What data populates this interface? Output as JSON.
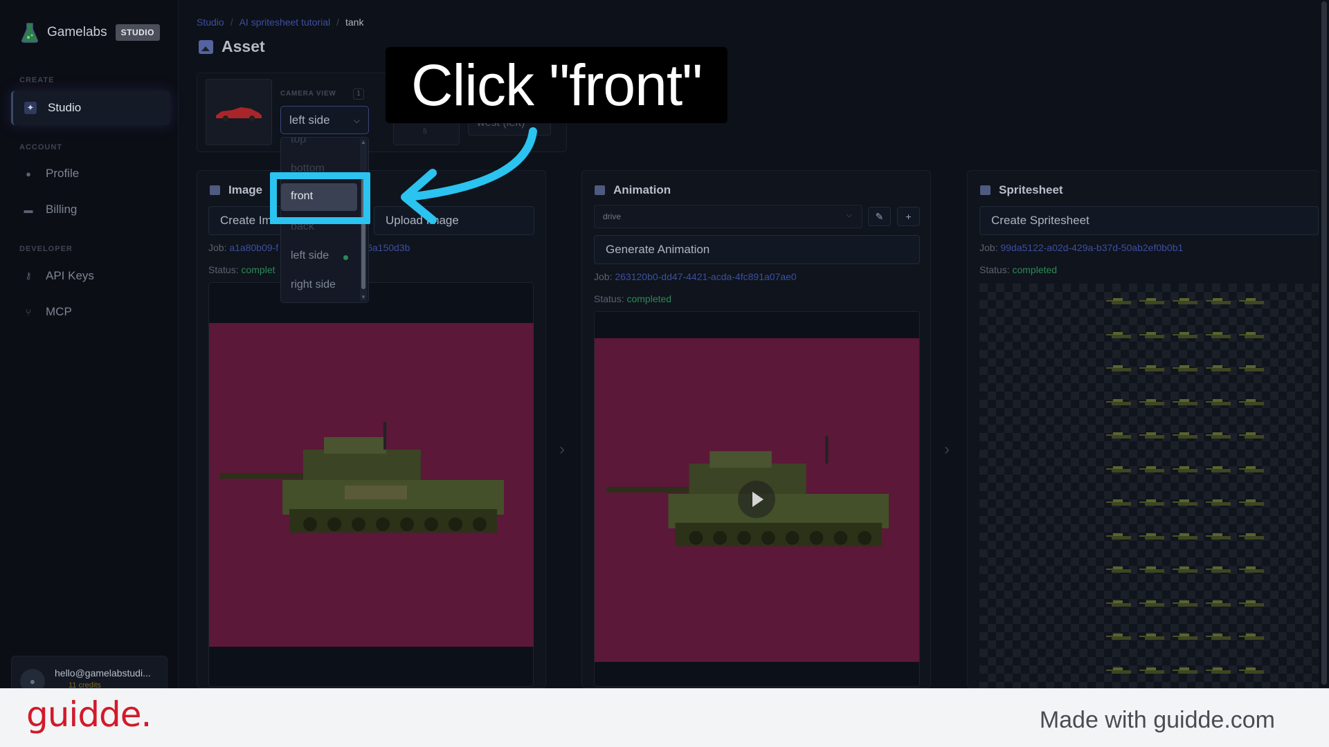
{
  "app": {
    "name": "Gamelabs",
    "badge": "STUDIO"
  },
  "sidebar": {
    "create_label": "CREATE",
    "account_label": "ACCOUNT",
    "developer_label": "DEVELOPER",
    "items": [
      {
        "label": "Studio",
        "icon": "wand-icon",
        "active": true
      },
      {
        "label": "Profile",
        "icon": "user-icon"
      },
      {
        "label": "Billing",
        "icon": "card-icon"
      },
      {
        "label": "API Keys",
        "icon": "key-icon"
      },
      {
        "label": "MCP",
        "icon": "mcp-icon"
      }
    ],
    "user": {
      "email": "hello@gamelabstudi...",
      "credits": "11 credits"
    }
  },
  "breadcrumb": {
    "root": "Studio",
    "project": "AI spritesheet tutorial",
    "current": "tank",
    "sep": "/"
  },
  "page": {
    "title": "Asset"
  },
  "camera": {
    "label": "CAMERA VIEW",
    "count": "1",
    "selected": "left side",
    "direction_value": "west (left)",
    "direction_number": "5",
    "options": [
      "top",
      "bottom",
      "front",
      "back",
      "left side",
      "right side"
    ],
    "highlighted": "front"
  },
  "callout": {
    "text": "Click \"front\""
  },
  "image_card": {
    "title": "Image",
    "create_button": "Create Im",
    "upload_button": "Upload Image",
    "job_label": "Job:",
    "job_value_a": "a1a80b09-f",
    "job_value_b": "6a150d3b",
    "status_label": "Status:",
    "status_value": "complet"
  },
  "animation_card": {
    "title": "Animation",
    "animation_select": "drive",
    "generate_button": "Generate Animation",
    "job_label": "Job:",
    "job_value": "263120b0-dd47-4421-acda-4fc891a07ae0",
    "status_label": "Status:",
    "status_value": "completed"
  },
  "spritesheet_card": {
    "title": "Spritesheet",
    "create_button": "Create Spritesheet",
    "job_label": "Job:",
    "job_value": "99da5122-a02d-429a-b37d-50ab2ef0b0b1",
    "status_label": "Status:",
    "status_value": "completed"
  },
  "footer": {
    "brand": "guidde.",
    "made_with": "Made with guidde.com"
  },
  "colors": {
    "accent": "#2bc3f0",
    "brand_red": "#d11a2a",
    "status_green": "#2c8a55",
    "magenta_bg": "#5b1838"
  }
}
